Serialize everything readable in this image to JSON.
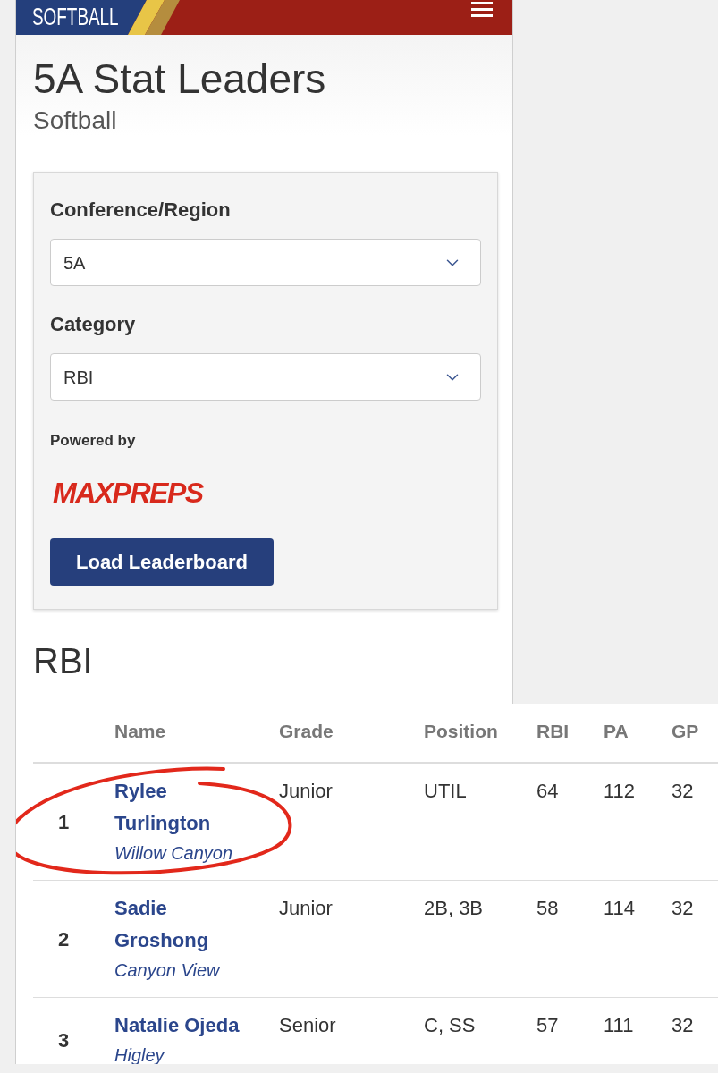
{
  "header": {
    "title": "SOFTBALL"
  },
  "page": {
    "title": "5A Stat Leaders",
    "subtitle": "Softball"
  },
  "filters": {
    "fields": [
      {
        "label": "Conference/Region",
        "value": "5A"
      },
      {
        "label": "Category",
        "value": "RBI"
      }
    ],
    "powered_by": "Powered by",
    "logo": "MAXPREPS",
    "button": "Load Leaderboard"
  },
  "leaderboard": {
    "title": "RBI",
    "columns": [
      "Name",
      "Grade",
      "Position",
      "RBI",
      "PA",
      "GP"
    ],
    "rows": [
      {
        "rank": "1",
        "name": "Rylee Turlington",
        "school": "Willow Canyon",
        "grade": "Junior",
        "position": "UTIL",
        "rbi": "64",
        "pa": "112",
        "gp": "32",
        "circled": true
      },
      {
        "rank": "2",
        "name": "Sadie Groshong",
        "school": "Canyon View",
        "grade": "Junior",
        "position": "2B, 3B",
        "rbi": "58",
        "pa": "114",
        "gp": "32",
        "circled": false
      },
      {
        "rank": "3",
        "name": "Natalie Ojeda",
        "school": "Higley",
        "grade": "Senior",
        "position": "C, SS",
        "rbi": "57",
        "pa": "111",
        "gp": "32",
        "circled": false
      }
    ]
  }
}
